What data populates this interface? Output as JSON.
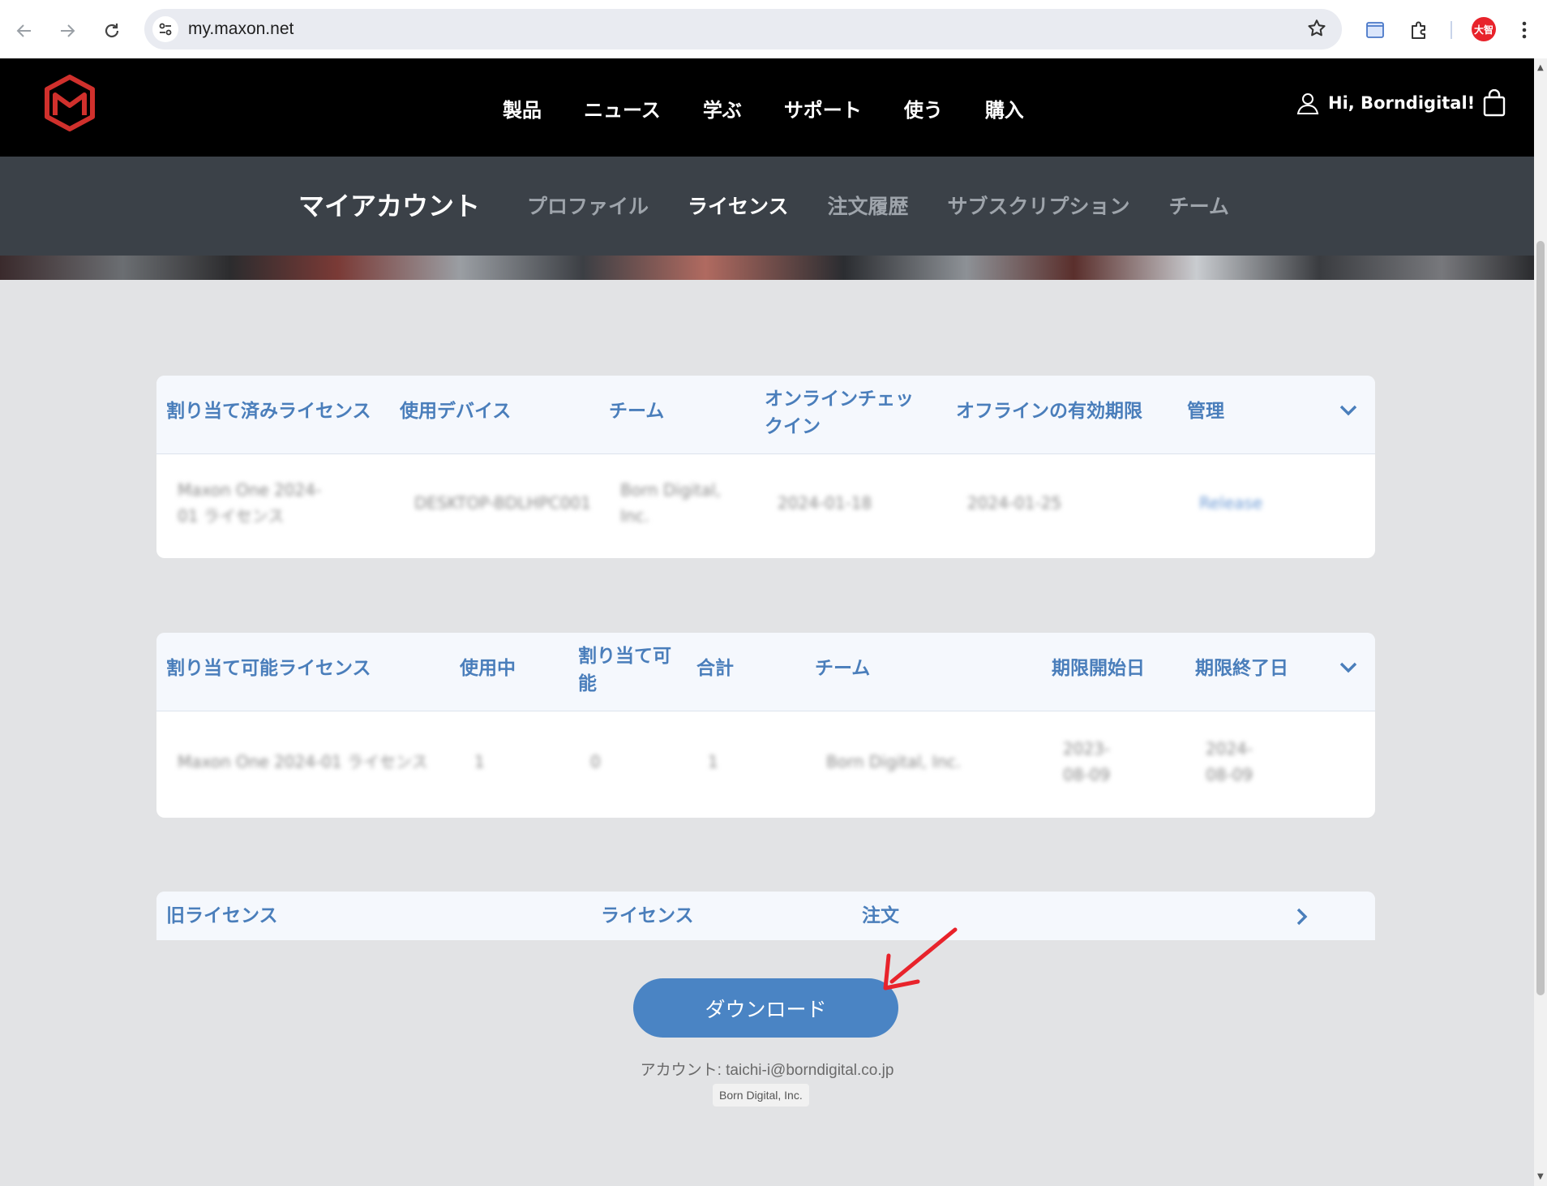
{
  "browser": {
    "url": "my.maxon.net",
    "profile_initials": "大智"
  },
  "header": {
    "nav": [
      "製品",
      "ニュース",
      "学ぶ",
      "サポート",
      "使う",
      "購入"
    ],
    "greeting": "Hi, Borndigital!"
  },
  "account_nav": {
    "title": "マイアカウント",
    "tabs": [
      "プロファイル",
      "ライセンス",
      "注文履歴",
      "サブスクリプション",
      "チーム"
    ],
    "active_tab": "ライセンス"
  },
  "assigned": {
    "headers": [
      "割り当て済みライセンス",
      "使用デバイス",
      "チーム",
      "オンラインチェックイン",
      "オフラインの有効期限",
      "管理"
    ],
    "row": [
      "Maxon One 2024-01 ライセンス",
      "DESKTOP-BDLHPC001",
      "Born Digital, Inc.",
      "2024-01-18",
      "2024-01-25",
      "Release"
    ]
  },
  "assignable": {
    "headers": [
      "割り当て可能ライセンス",
      "使用中",
      "割り当て可能",
      "合計",
      "チーム",
      "期限開始日",
      "期限終了日"
    ],
    "row": [
      "Maxon One 2024-01 ライセンス",
      "1",
      "0",
      "1",
      "Born Digital, Inc.",
      "2023-08-09",
      "2024-08-09"
    ]
  },
  "legacy": {
    "headers": [
      "旧ライセンス",
      "ライセンス",
      "注文"
    ]
  },
  "download_label": "ダウンロード",
  "account_label": "アカウント: taichi-i@borndigital.co.jp",
  "company": "Born Digital, Inc.",
  "colors": {
    "accent": "#4a84c4",
    "header_text": "#4a7ebb",
    "annotation": "#e8232b"
  }
}
